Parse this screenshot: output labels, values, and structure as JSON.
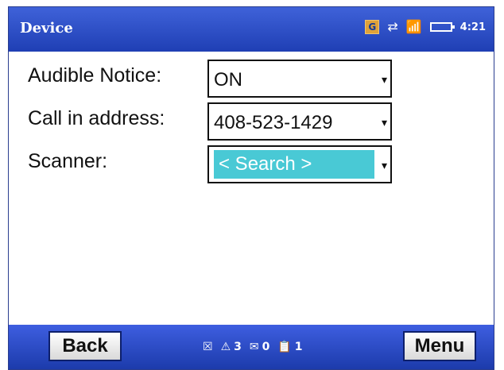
{
  "titlebar": {
    "title": "Device",
    "g_badge": "G",
    "time": "4:21"
  },
  "form": {
    "rows": [
      {
        "label": "Audible Notice:",
        "value": "ON"
      },
      {
        "label": "Call in address:",
        "value": "408-523-1429"
      },
      {
        "label": "Scanner:",
        "value": "< Search >"
      }
    ]
  },
  "bottombar": {
    "back_label": "Back",
    "menu_label": "Menu",
    "notifications": {
      "alerts": "3",
      "messages": "0",
      "tasks": "1"
    }
  },
  "colors": {
    "titlebar": "#2f50c9",
    "highlight": "#49c9d5"
  },
  "icons": {
    "close": "close-box-icon",
    "warning": "warning-icon",
    "mail": "mail-icon",
    "clipboard": "clipboard-icon",
    "data": "data-transfer-icon",
    "signal": "signal-icon",
    "battery": "battery-icon"
  }
}
